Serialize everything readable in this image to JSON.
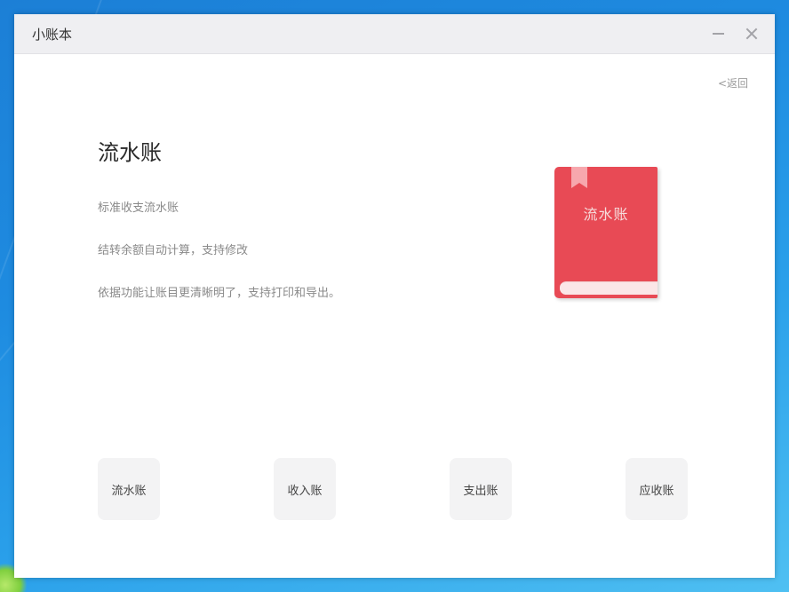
{
  "window": {
    "title": "小账本",
    "minimize_icon": "minimize-icon",
    "close_icon": "close-icon"
  },
  "back_link": {
    "label": "<返回"
  },
  "main": {
    "title": "流水账",
    "descriptions": [
      "标准收支流水账",
      "结转余额自动计算，支持修改",
      "依据功能让账目更清晰明了，支持打印和导出。"
    ]
  },
  "book_illustration": {
    "label": "流水账",
    "color": "#e84a55"
  },
  "nav_buttons": [
    {
      "label": "流水账"
    },
    {
      "label": "收入账"
    },
    {
      "label": "支出账"
    },
    {
      "label": "应收账"
    }
  ],
  "colors": {
    "accent": "#e84a55",
    "titlebar": "#efeff2",
    "desktop": "#1e8be0"
  }
}
